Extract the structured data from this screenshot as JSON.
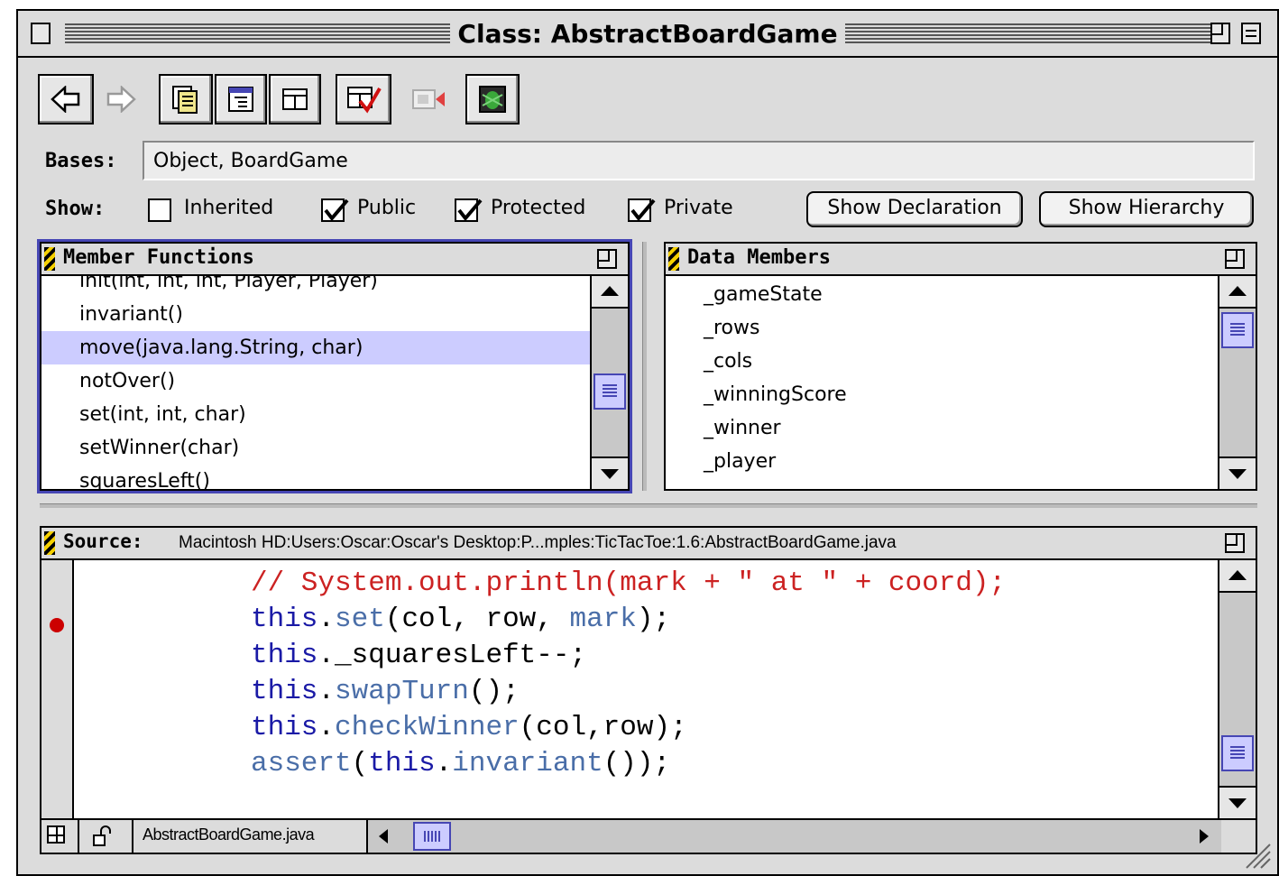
{
  "window": {
    "title": "Class: AbstractBoardGame"
  },
  "toolbar": {
    "buttons": [
      {
        "name": "back-arrow-icon"
      },
      {
        "name": "forward-arrow-icon"
      },
      {
        "name": "browse-contents-icon"
      },
      {
        "name": "hierarchy-icon"
      },
      {
        "name": "class-browser-icon"
      },
      {
        "name": "checked-window-icon"
      },
      {
        "name": "stop-record-icon"
      },
      {
        "name": "debug-bug-icon"
      }
    ]
  },
  "bases": {
    "label": "Bases:",
    "value": "Object, BoardGame"
  },
  "show": {
    "label": "Show:",
    "options": [
      {
        "label": "Inherited",
        "checked": false
      },
      {
        "label": "Public",
        "checked": true
      },
      {
        "label": "Protected",
        "checked": true
      },
      {
        "label": "Private",
        "checked": true
      }
    ],
    "show_declaration": "Show Declaration",
    "show_hierarchy": "Show Hierarchy"
  },
  "member_functions": {
    "title": "Member Functions",
    "items": [
      "init(int, int, int, Player, Player)",
      "invariant()",
      "move(java.lang.String, char)",
      "notOver()",
      "set(int, int, char)",
      "setWinner(char)",
      "squaresLeft()"
    ],
    "selected_index": 2
  },
  "data_members": {
    "title": "Data Members",
    "items": [
      "_gameState",
      "_rows",
      "_cols",
      "_winningScore",
      "_winner",
      "_player"
    ]
  },
  "source": {
    "label": "Source:",
    "path": "Macintosh HD:Users:Oscar:Oscar's Desktop:P...mples:TicTacToe:1.6:AbstractBoardGame.java",
    "filename": "AbstractBoardGame.java",
    "breakpoint_line": 2,
    "lines": [
      "// System.out.println(mark + \" at \" + coord);",
      "this.set(col, row, mark);",
      "this._squaresLeft--;",
      "this.swapTurn();",
      "this.checkWinner(col,row);",
      "assert(this.invariant());"
    ]
  },
  "colors": {
    "selection": "#ccccff",
    "comment": "#cc2222",
    "keyword": "#1a1aa6",
    "method": "#4a6ea8",
    "breakpoint": "#cc0000"
  }
}
